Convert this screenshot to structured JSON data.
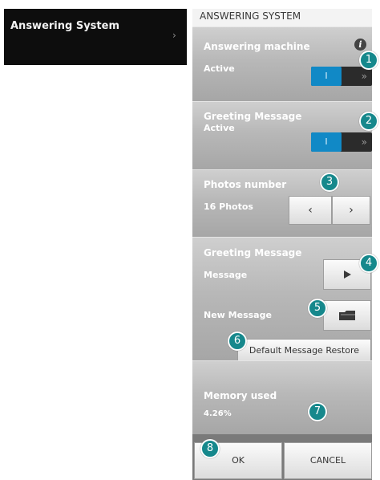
{
  "nav": {
    "item_label": "Answering System",
    "chevron": "›"
  },
  "panel": {
    "header_title": "ANSWERING SYSTEM"
  },
  "answering_machine": {
    "title": "Answering machine",
    "status": "Active",
    "toggle_on_label": "I",
    "toggle_arrows": "»",
    "info_icon": "i"
  },
  "greeting": {
    "title": "Greeting Message",
    "status": "Active",
    "toggle_on_label": "I",
    "toggle_arrows": "»"
  },
  "photos": {
    "title": "Photos number",
    "value": "16 Photos",
    "prev_icon": "‹",
    "next_icon": "›"
  },
  "greeting_message": {
    "title": "Greeting Message",
    "message_label": "Message",
    "new_message_label": "New Message",
    "restore_label": "Default Message Restore"
  },
  "memory": {
    "title": "Memory used",
    "value": "4.26%"
  },
  "footer": {
    "ok_label": "OK",
    "cancel_label": "CANCEL"
  },
  "badges": [
    "1",
    "2",
    "3",
    "4",
    "5",
    "6",
    "7",
    "8"
  ],
  "colors": {
    "toggle_on": "#1189c6",
    "badge": "#16888c",
    "nav_bg": "#0d0d0d"
  },
  "icons": {
    "play": "play-icon",
    "folder": "folder-icon",
    "info": "info-icon"
  }
}
